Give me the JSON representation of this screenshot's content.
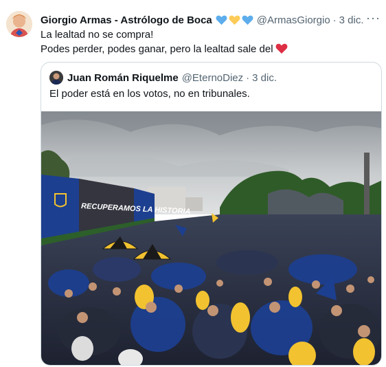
{
  "tweet": {
    "author_name": "Giorgio Armas - Astrólogo de Boca",
    "name_emojis": [
      "blue-heart",
      "yellow-heart",
      "blue-heart"
    ],
    "handle": "@ArmasGiorgio",
    "separator": "·",
    "date": "3 dic.",
    "more_label": "···",
    "text_line1": "La lealtad no se compra!",
    "text_line2": "Podes perder, podes ganar, pero la lealtad sale del",
    "text_emoji": "red-heart"
  },
  "quote": {
    "author_name": "Juan Román Riquelme",
    "handle": "@EternoDiez",
    "separator": "·",
    "date": "3 dic.",
    "text": "El poder está en los votos, no en tribunales.",
    "banner_text": "RECUPERAMOS LA HISTORIA"
  },
  "colors": {
    "blue_heart": "#5dadec",
    "yellow_heart": "#fdcb58",
    "red_heart": "#dd2e44",
    "boca_blue": "#1d3f8f",
    "boca_yellow": "#f2c230",
    "secondary_text": "#536471",
    "border": "#cfd9de"
  }
}
